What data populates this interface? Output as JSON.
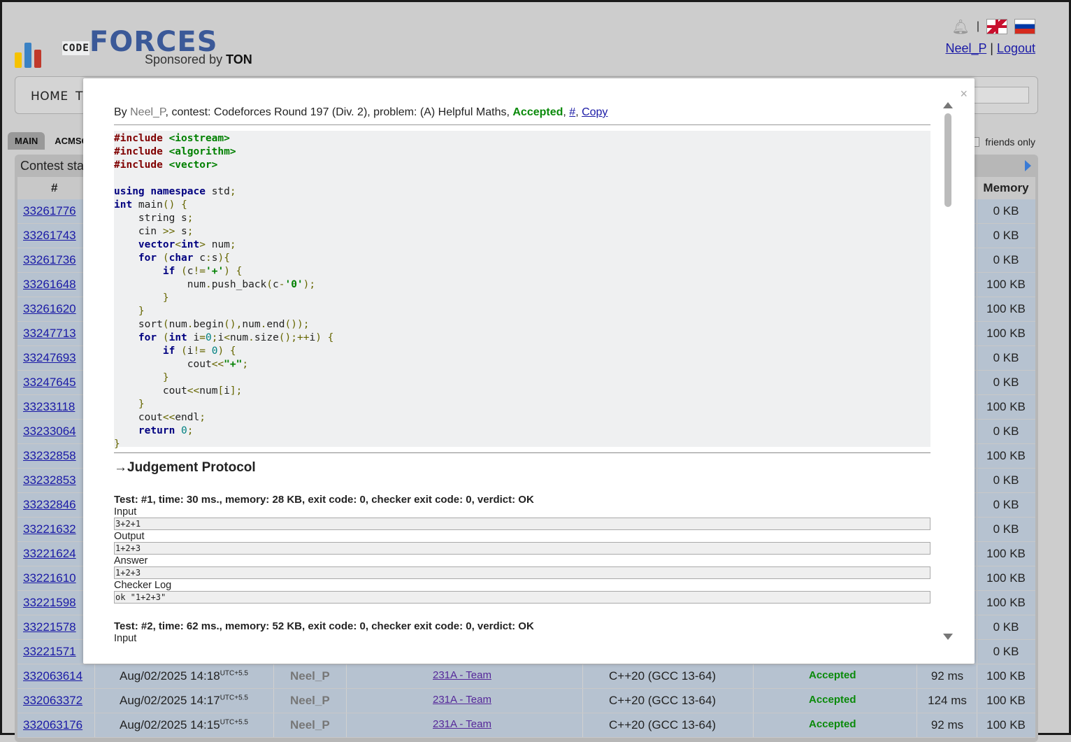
{
  "header": {
    "logo_code": "CODE",
    "logo_forces": "FORCES",
    "logo_sponsor_prefix": "Sponsored by",
    "logo_sponsor_brand": "TON",
    "user_link": "Neel_P",
    "separator": "|",
    "logout_link": "Logout",
    "brand_colors": [
      "#f6c200",
      "#3b82c4",
      "#c0392b"
    ]
  },
  "nav": {
    "home": "HOME",
    "truncated_item": "TO"
  },
  "tabs": [
    "MAIN",
    "ACMSGUI"
  ],
  "friends_only": "friends only",
  "table": {
    "title": "Contest sta",
    "col_num": "#",
    "col_memory": "Memory",
    "rows": [
      {
        "id": "33261776",
        "date": "",
        "user": "",
        "problem": "",
        "lang": "",
        "verdict": "",
        "time": "",
        "mem": "0 KB"
      },
      {
        "id": "33261743",
        "date": "",
        "user": "",
        "problem": "",
        "lang": "",
        "verdict": "",
        "time": "",
        "mem": "0 KB"
      },
      {
        "id": "33261736",
        "date": "",
        "user": "",
        "problem": "",
        "lang": "",
        "verdict": "",
        "time": "",
        "mem": "0 KB"
      },
      {
        "id": "33261648",
        "date": "",
        "user": "",
        "problem": "",
        "lang": "",
        "verdict": "",
        "time": "",
        "mem": "100 KB"
      },
      {
        "id": "33261620",
        "date": "",
        "user": "",
        "problem": "",
        "lang": "",
        "verdict": "",
        "time": "",
        "mem": "100 KB"
      },
      {
        "id": "33247713",
        "date": "",
        "user": "",
        "problem": "",
        "lang": "",
        "verdict": "",
        "time": "",
        "mem": "100 KB"
      },
      {
        "id": "33247693",
        "date": "",
        "user": "",
        "problem": "",
        "lang": "",
        "verdict": "",
        "time": "",
        "mem": "0 KB"
      },
      {
        "id": "33247645",
        "date": "",
        "user": "",
        "problem": "",
        "lang": "",
        "verdict": "",
        "time": "",
        "mem": "0 KB"
      },
      {
        "id": "33233118",
        "date": "",
        "user": "",
        "problem": "",
        "lang": "",
        "verdict": "",
        "time": "",
        "mem": "100 KB"
      },
      {
        "id": "33233064",
        "date": "",
        "user": "",
        "problem": "",
        "lang": "",
        "verdict": "",
        "time": "",
        "mem": "0 KB"
      },
      {
        "id": "33232858",
        "date": "",
        "user": "",
        "problem": "",
        "lang": "",
        "verdict": "",
        "time": "",
        "mem": "100 KB"
      },
      {
        "id": "33232853",
        "date": "",
        "user": "",
        "problem": "",
        "lang": "",
        "verdict": "",
        "time": "",
        "mem": "0 KB"
      },
      {
        "id": "33232846",
        "date": "",
        "user": "",
        "problem": "",
        "lang": "",
        "verdict": "",
        "time": "",
        "mem": "0 KB"
      },
      {
        "id": "33221632",
        "date": "",
        "user": "",
        "problem": "",
        "lang": "",
        "verdict": "",
        "time": "",
        "mem": "0 KB"
      },
      {
        "id": "33221624",
        "date": "",
        "user": "",
        "problem": "",
        "lang": "",
        "verdict": "",
        "time": "",
        "mem": "100 KB"
      },
      {
        "id": "33221610",
        "date": "",
        "user": "",
        "problem": "",
        "lang": "",
        "verdict": "",
        "time": "",
        "mem": "100 KB"
      },
      {
        "id": "33221598",
        "date": "",
        "user": "",
        "problem": "",
        "lang": "",
        "verdict": "",
        "time": "",
        "mem": "100 KB"
      },
      {
        "id": "33221578",
        "date": "",
        "user": "",
        "problem": "",
        "lang": "",
        "verdict": "",
        "time": "",
        "mem": "0 KB"
      },
      {
        "id": "33221571",
        "date": "",
        "user": "",
        "problem": "",
        "lang": "",
        "verdict": "",
        "time": "",
        "mem": "0 KB"
      },
      {
        "id": "332063614",
        "date": "Aug/02/2025 14:18",
        "tz": "UTC+5.5",
        "user": "Neel_P",
        "problem": "231A - Team",
        "lang": "C++20 (GCC 13-64)",
        "verdict": "Accepted",
        "time": "92 ms",
        "mem": "100 KB"
      },
      {
        "id": "332063372",
        "date": "Aug/02/2025 14:17",
        "tz": "UTC+5.5",
        "user": "Neel_P",
        "problem": "231A - Team",
        "lang": "C++20 (GCC 13-64)",
        "verdict": "Accepted",
        "time": "124 ms",
        "mem": "100 KB"
      },
      {
        "id": "332063176",
        "date": "Aug/02/2025 14:15",
        "tz": "UTC+5.5",
        "user": "Neel_P",
        "problem": "231A - Team",
        "lang": "C++20 (GCC 13-64)",
        "verdict": "Accepted",
        "time": "92 ms",
        "mem": "100 KB"
      }
    ]
  },
  "modal": {
    "close": "×",
    "info": {
      "by": "By ",
      "author": "Neel_P",
      "contest_part": ", contest: Codeforces Round 197 (Div. 2), problem: (A) Helpful Maths, ",
      "verdict": "Accepted",
      "comma1": ", ",
      "hash_link": "#",
      "comma2": ", ",
      "copy_link": "Copy"
    },
    "code_lines": [
      "#include <iostream>",
      "#include <algorithm>",
      "#include <vector>",
      "",
      "using namespace std;",
      "int main() {",
      "    string s;",
      "    cin >> s;",
      "    vector<int> num;",
      "    for (char c:s){",
      "        if (c!='+') {",
      "            num.push_back(c-'0');",
      "        }",
      "    }",
      "    sort(num.begin(),num.end());",
      "    for (int i=0;i<num.size();++i) {",
      "        if (i!= 0) {",
      "            cout<<\"+\";",
      "        }",
      "        cout<<num[i];",
      "    }",
      "    cout<<endl;",
      "    return 0;",
      "}"
    ],
    "judgement_title": "→Judgement Protocol",
    "test1": {
      "head": "Test: #1, time: 30 ms., memory: 28 KB, exit code: 0, checker exit code: 0, verdict: OK",
      "input_label": "Input",
      "input": "3+2+1",
      "output_label": "Output",
      "output": "1+2+3",
      "answer_label": "Answer",
      "answer": "1+2+3",
      "checker_label": "Checker Log",
      "checker": "ok \"1+2+3\""
    },
    "test2": {
      "head": "Test: #2, time: 62 ms., memory: 52 KB, exit code: 0, checker exit code: 0, verdict: OK",
      "input_label": "Input"
    }
  }
}
